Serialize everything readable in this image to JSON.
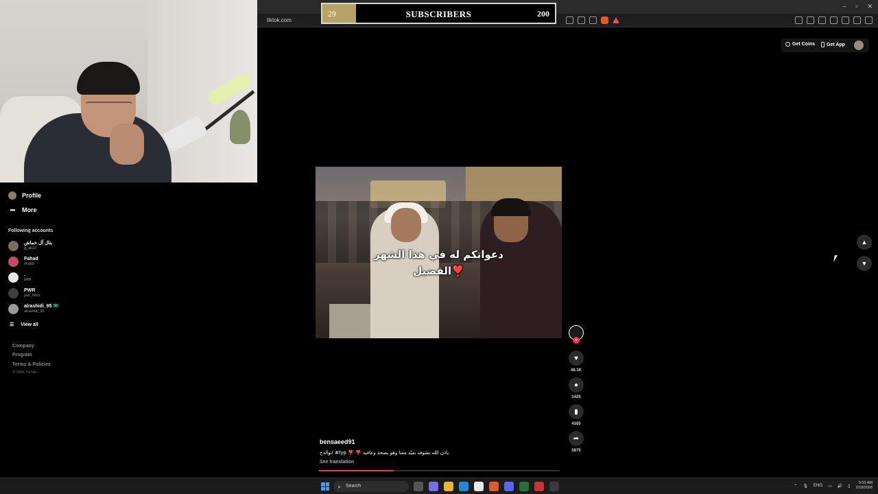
{
  "browser": {
    "url": "tiktok.com",
    "window_controls": [
      "–",
      "▫",
      "✕"
    ]
  },
  "subscriber_goal": {
    "current": "29",
    "label": "SUBSCRIBERS",
    "goal": "200",
    "progress": 0.145,
    "fill_color": "#b6a467"
  },
  "sidebar": {
    "nav": [
      {
        "label": "Profile",
        "icon": "avatar"
      },
      {
        "label": "More",
        "icon": "more-dots-icon"
      }
    ],
    "following_label": "Following accounts",
    "accounts": [
      {
        "name": "بتال آل خماش",
        "handle": "g_ak10"
      },
      {
        "name": "Fahad",
        "handle": "ifhd89"
      },
      {
        "name": ".",
        "handle": "848l"
      },
      {
        "name": "PWR",
        "handle": "pwr_films"
      },
      {
        "name": "alrashidi_95 🇸🇦",
        "handle": "alrashidi_95"
      }
    ],
    "view_all": "View all",
    "footer_links": [
      "Company",
      "Program",
      "Terms & Policies"
    ],
    "copyright": "© 2026 TikTok"
  },
  "header": {
    "get_coins": "Get Coins",
    "get_app": "Get App"
  },
  "video": {
    "caption_line1": "دعواتكم له في هذا الشهر",
    "caption_line2": "الفضيل❣️",
    "author": "bensaeed91",
    "description": "ابوالدح #fyp ❣️ ❣️ باذن الله نشوفه بعيّد معنا وهو بصحة وعافية",
    "see_translation": "See translation",
    "progress": 0.31,
    "accent": "#fe2c55"
  },
  "actions": {
    "likes": "46.1K",
    "comments": "1425",
    "saves": "4165",
    "shares": "5875"
  },
  "taskbar": {
    "search_label": "Search",
    "lang": "ENG",
    "time": "5:03 AM",
    "date": "2/18/2026"
  }
}
